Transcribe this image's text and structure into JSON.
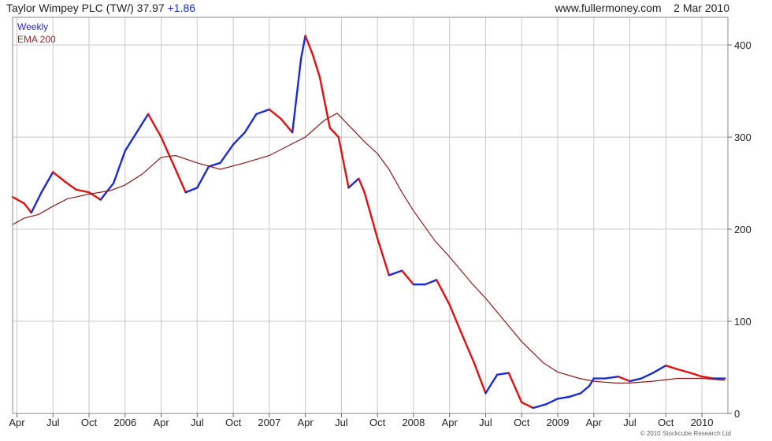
{
  "header": {
    "title": "Taylor Wimpey PLC (TW/) 37.97",
    "change": "+1.86",
    "site": "www.fullermoney.com",
    "date": "2 Mar 2010"
  },
  "footer": {
    "copyright": "© 2010 Stockcube Research Ltd"
  },
  "colors": {
    "up": "#1a2bd6",
    "down": "#e01010",
    "ema": "#8b1a1a",
    "grid": "#c8c8c8"
  },
  "chart_data": {
    "type": "line",
    "title": "Taylor Wimpey PLC (TW/) 37.97 +1.86",
    "x_tick_labels": [
      "Apr",
      "Jul",
      "Oct",
      "2006",
      "Apr",
      "Jul",
      "Oct",
      "2007",
      "Apr",
      "Jul",
      "Oct",
      "2008",
      "Apr",
      "Jul",
      "Oct",
      "2009",
      "Apr",
      "Jul",
      "Oct",
      "2010"
    ],
    "x_tick_positions": [
      2005.25,
      2005.5,
      2005.75,
      2006.0,
      2006.25,
      2006.5,
      2006.75,
      2007.0,
      2007.25,
      2007.5,
      2007.75,
      2008.0,
      2008.25,
      2008.5,
      2008.75,
      2009.0,
      2009.25,
      2009.5,
      2009.75,
      2010.0
    ],
    "y_ticks": [
      0,
      100,
      200,
      300,
      400
    ],
    "xlim": [
      2005.22,
      2010.18
    ],
    "ylim": [
      0,
      430
    ],
    "y_axis_side": "right",
    "grid": true,
    "legend_position": "top-left",
    "series": [
      {
        "name": "Weekly",
        "color": "#1a2bd6",
        "x": [
          2005.22,
          2005.3,
          2005.35,
          2005.42,
          2005.5,
          2005.58,
          2005.66,
          2005.75,
          2005.83,
          2005.92,
          2006.0,
          2006.08,
          2006.16,
          2006.25,
          2006.33,
          2006.42,
          2006.5,
          2006.58,
          2006.66,
          2006.75,
          2006.83,
          2006.91,
          2007.0,
          2007.08,
          2007.16,
          2007.22,
          2007.25,
          2007.3,
          2007.35,
          2007.42,
          2007.48,
          2007.55,
          2007.62,
          2007.66,
          2007.75,
          2007.83,
          2007.92,
          2008.0,
          2008.08,
          2008.16,
          2008.25,
          2008.33,
          2008.42,
          2008.5,
          2008.58,
          2008.66,
          2008.75,
          2008.83,
          2008.92,
          2009.0,
          2009.08,
          2009.16,
          2009.22,
          2009.25,
          2009.33,
          2009.42,
          2009.5,
          2009.58,
          2009.66,
          2009.75,
          2009.83,
          2009.92,
          2010.0,
          2010.08,
          2010.16
        ],
        "y": [
          235,
          228,
          218,
          240,
          262,
          252,
          243,
          240,
          232,
          250,
          285,
          305,
          325,
          300,
          272,
          240,
          245,
          268,
          272,
          292,
          305,
          325,
          330,
          320,
          305,
          385,
          410,
          390,
          365,
          310,
          300,
          245,
          255,
          240,
          190,
          150,
          155,
          140,
          140,
          145,
          118,
          88,
          55,
          22,
          42,
          44,
          12,
          6,
          10,
          16,
          18,
          22,
          30,
          38,
          38,
          40,
          35,
          38,
          44,
          52,
          48,
          44,
          40,
          38,
          38
        ]
      },
      {
        "name": "EMA 200",
        "color": "#8b1a1a",
        "x": [
          2005.22,
          2005.3,
          2005.4,
          2005.5,
          2005.6,
          2005.75,
          2005.9,
          2006.0,
          2006.12,
          2006.25,
          2006.35,
          2006.5,
          2006.66,
          2006.83,
          2007.0,
          2007.15,
          2007.25,
          2007.38,
          2007.47,
          2007.55,
          2007.66,
          2007.75,
          2007.83,
          2007.92,
          2008.0,
          2008.15,
          2008.25,
          2008.4,
          2008.5,
          2008.66,
          2008.75,
          2008.9,
          2009.0,
          2009.15,
          2009.25,
          2009.4,
          2009.5,
          2009.66,
          2009.83,
          2010.0,
          2010.16
        ],
        "y": [
          205,
          212,
          216,
          225,
          233,
          238,
          242,
          248,
          260,
          278,
          280,
          272,
          265,
          272,
          280,
          292,
          300,
          318,
          326,
          313,
          295,
          282,
          265,
          240,
          220,
          187,
          170,
          142,
          125,
          95,
          78,
          55,
          45,
          38,
          35,
          33,
          33,
          35,
          38,
          38,
          36
        ]
      }
    ]
  }
}
